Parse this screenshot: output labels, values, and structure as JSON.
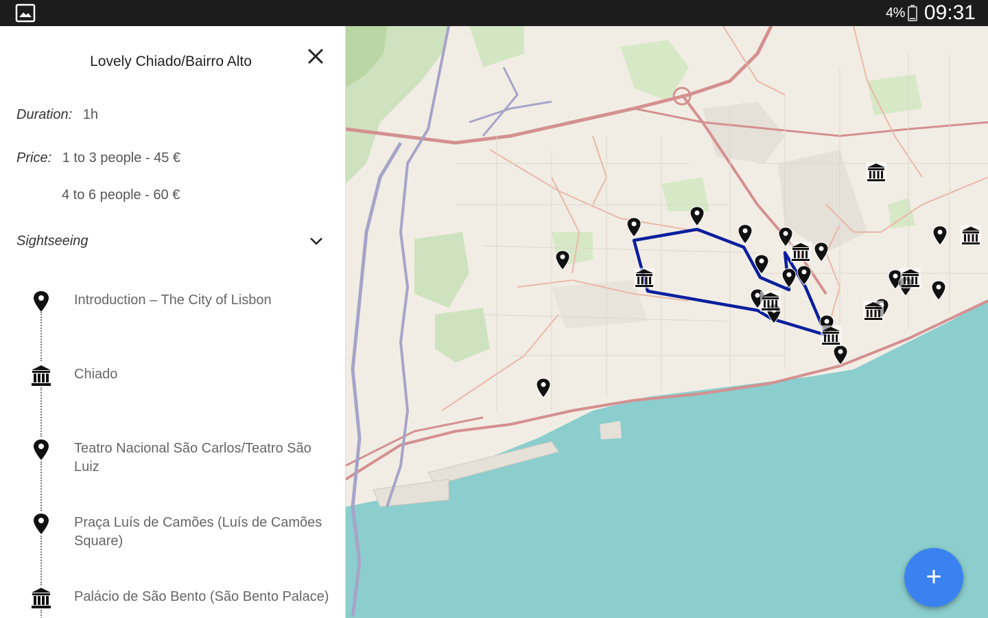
{
  "status_bar": {
    "battery_percent": "4%",
    "time": "09:31",
    "left_icon": "gallery-icon",
    "background": "#1c1c1c"
  },
  "panel": {
    "title": "Lovely Chiado/Bairro Alto",
    "duration_label": "Duration:",
    "duration_value": "1h",
    "price_label": "Price:",
    "price_values": [
      "1 to 3 people - 45 €",
      "4 to 6 people - 60 €"
    ],
    "section_label": "Sightseeing",
    "section_icon": "chevron-down-icon",
    "close_icon": "close-icon",
    "stops": [
      {
        "label": "Introduction – The City of Lisbon",
        "icon": "map-pin-icon"
      },
      {
        "label": "Chiado",
        "icon": "museum-icon"
      },
      {
        "label": "Teatro Nacional São Carlos/Teatro São Luiz",
        "icon": "map-pin-icon"
      },
      {
        "label": "Praça Luís de Camões (Luís de Camões Square)",
        "icon": "map-pin-icon"
      },
      {
        "label": "Palácio de São Bento (São Bento Palace)",
        "icon": "museum-icon"
      }
    ]
  },
  "map": {
    "route_color": "#0a1f9c",
    "water_color": "#8ccdcd",
    "fab_label": "+",
    "fab_color": "#3b82f0"
  }
}
